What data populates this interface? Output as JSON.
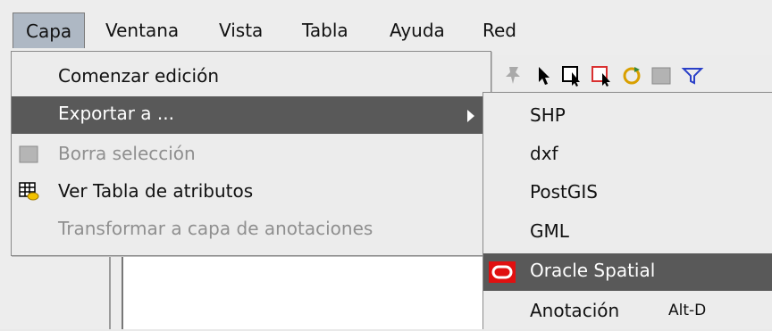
{
  "menubar": {
    "items": [
      "Capa",
      "Ventana",
      "Vista",
      "Tabla",
      "Ayuda",
      "Red"
    ]
  },
  "menu": {
    "items": [
      {
        "label": "Comenzar edición",
        "state": "normal"
      },
      {
        "label": "Exportar a ...",
        "state": "highlighted",
        "submenu": true
      },
      {
        "label": "Borra selección",
        "state": "disabled",
        "icon": "clear-selection-icon"
      },
      {
        "label": "Ver Tabla de atributos",
        "state": "normal",
        "icon": "attribute-table-icon"
      },
      {
        "label": "Transformar a capa de anotaciones",
        "state": "disabled"
      }
    ]
  },
  "submenu": {
    "items": [
      {
        "label": "SHP"
      },
      {
        "label": "dxf"
      },
      {
        "label": "PostGIS"
      },
      {
        "label": "GML"
      },
      {
        "label": "Oracle Spatial",
        "state": "highlighted",
        "icon": "oracle-icon"
      },
      {
        "label": "Anotación",
        "shortcut": "Alt-D"
      }
    ]
  },
  "toolbar": {
    "icons": [
      "edit-pin-icon",
      "pointer-icon",
      "select-rect-icon",
      "select-by-point-icon",
      "refresh-selection-icon",
      "layer-icon",
      "filter-icon"
    ]
  },
  "colors": {
    "highlight": "#595959",
    "menu_bg": "#ececec",
    "oracle_red": "#e01010"
  }
}
